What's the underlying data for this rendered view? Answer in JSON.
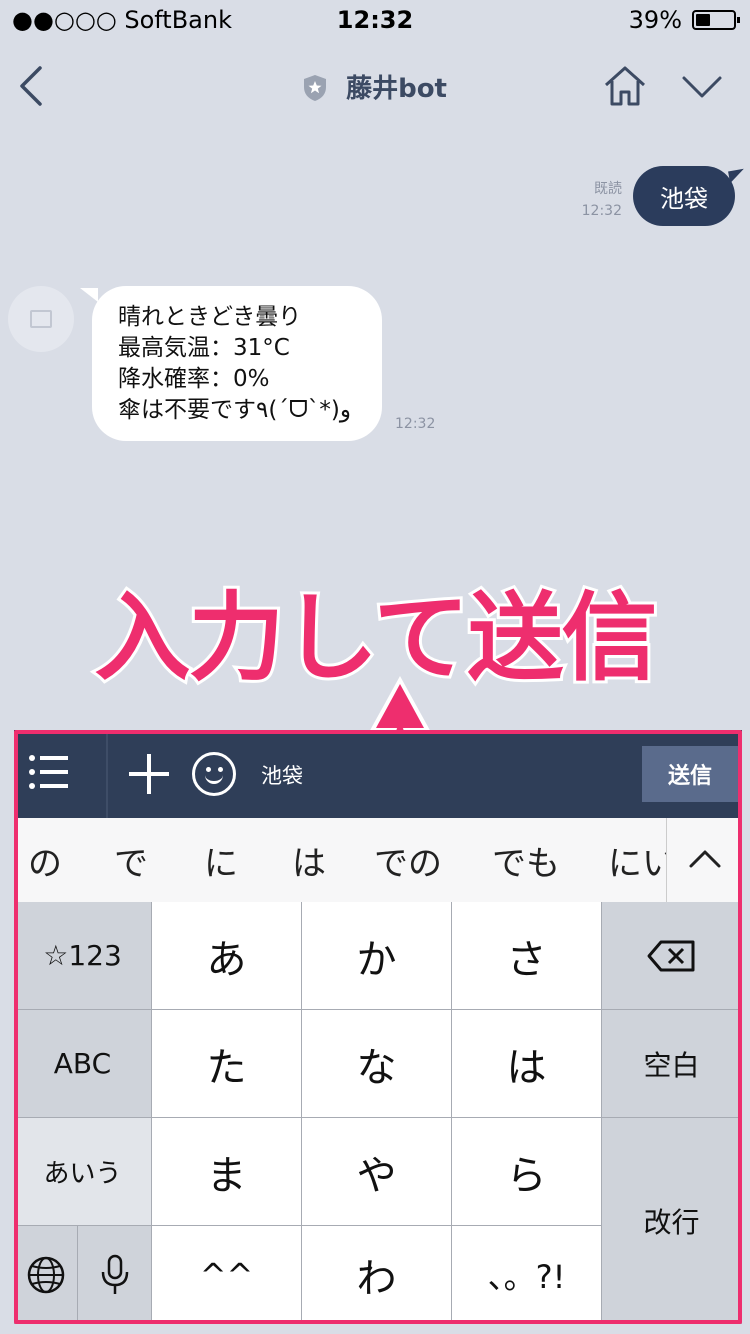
{
  "status": {
    "carrier": "●●○○○ SoftBank",
    "time": "12:32",
    "battery": "39%",
    "battery_fraction": 0.39
  },
  "nav": {
    "title": "藤井bot"
  },
  "chat": {
    "sent": {
      "text": "池袋",
      "read": "既読",
      "time": "12:32"
    },
    "received": {
      "lines": [
        "晴れときどき曇り",
        "最高気温：31°C",
        "降水確率：0%",
        "傘は不要です٩(ˊᗜˋ*)و"
      ],
      "time": "12:32"
    }
  },
  "annotation": {
    "text": "入力して送信"
  },
  "input": {
    "text": "池袋",
    "send_label": "送信"
  },
  "candidates": [
    "の",
    "で",
    "に",
    "は",
    "での",
    "でも",
    "にい"
  ],
  "keyboard": {
    "rows": [
      [
        "☆123",
        "あ",
        "か",
        "さ",
        "⌫"
      ],
      [
        "ABC",
        "た",
        "な",
        "は",
        "空白"
      ],
      [
        "あいう",
        "ま",
        "や",
        "ら",
        "改行"
      ],
      [
        "🌐",
        "🎤",
        "^^",
        "わ",
        "、。?!"
      ]
    ],
    "return_label": "改行",
    "space_label": "空白"
  },
  "colors": {
    "accent": "#ee2e6e",
    "navy": "#2b3c5c",
    "bg": "#d9dde6"
  }
}
